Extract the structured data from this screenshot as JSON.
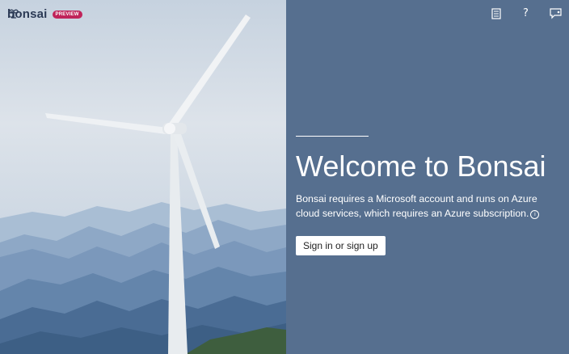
{
  "brand": {
    "name": "bonsai",
    "badge": "PREVIEW"
  },
  "header": {
    "icons": [
      "notes-icon",
      "help-icon",
      "feedback-icon"
    ],
    "help_glyph": "?"
  },
  "main": {
    "title": "Welcome to Bonsai",
    "description": "Bonsai requires a Microsoft account and runs on Azure cloud services, which requires an Azure subscription.",
    "info_glyph": "i",
    "signin_label": "Sign in or sign up"
  },
  "colors": {
    "panel": "#566f8f",
    "badge": "#c0245a",
    "button_bg": "#ffffff"
  }
}
